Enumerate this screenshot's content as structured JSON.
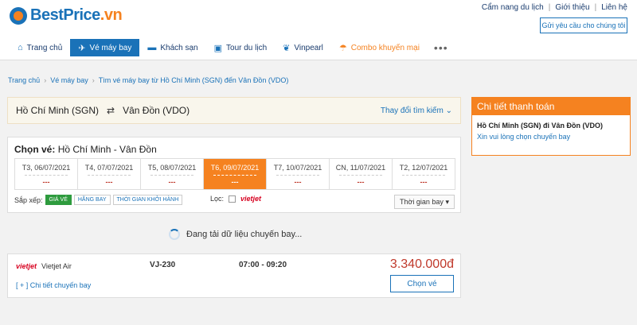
{
  "brand": {
    "name_main": "BestPrice",
    "name_suffix": ".vn"
  },
  "toplinks": [
    "Cẩm nang du lịch",
    "Giới thiệu",
    "Liên hệ"
  ],
  "support_button": "Gửi yêu cầu cho chúng tôi",
  "nav": [
    {
      "label": "Trang chủ",
      "icon": "home-icon"
    },
    {
      "label": "Vé máy bay",
      "icon": "plane-icon",
      "active": true
    },
    {
      "label": "Khách sạn",
      "icon": "bed-icon"
    },
    {
      "label": "Tour du lịch",
      "icon": "luggage-icon"
    },
    {
      "label": "Vinpearl",
      "icon": "vinpearl-icon"
    },
    {
      "label": "Combo khuyến mại",
      "icon": "beach-icon"
    }
  ],
  "nav_more": "•••",
  "breadcrumb": [
    "Trang chủ",
    "Vé máy bay",
    "Tìm vé máy bay từ Hồ Chí Minh (SGN) đến Vân Đồn (VDO)"
  ],
  "route": {
    "from": "Hồ Chí Minh (SGN)",
    "swap_icon": "⇄",
    "to": "Vân Đồn (VDO)",
    "change_label": "Thay đổi tìm kiếm"
  },
  "select": {
    "title_prefix": "Chọn vé:",
    "title_route": "Hồ Chí Minh - Vân Đồn"
  },
  "dates": [
    {
      "label": "T3, 06/07/2021",
      "price": "---"
    },
    {
      "label": "T4, 07/07/2021",
      "price": "---"
    },
    {
      "label": "T5, 08/07/2021",
      "price": "---"
    },
    {
      "label": "T6, 09/07/2021",
      "price": "---",
      "active": true
    },
    {
      "label": "T7, 10/07/2021",
      "price": "---"
    },
    {
      "label": "CN, 11/07/2021",
      "price": "---"
    },
    {
      "label": "T2, 12/07/2021",
      "price": "---"
    }
  ],
  "sort": {
    "label": "Sắp xếp:",
    "options": [
      "GIÁ VÉ",
      "HÃNG BAY",
      "THỜI GIAN KHỞI HÀNH"
    ]
  },
  "filter": {
    "label": "Lọc:",
    "airline": "vietjet"
  },
  "time_select": "Thời gian bay",
  "loading_text": "Đang tải dữ liệu chuyến bay...",
  "flight": {
    "airline_logo": "vietjet",
    "airline": "Vietjet Air",
    "code": "VJ-230",
    "time": "07:00 - 09:20",
    "price": "3.340.000đ",
    "detail_link": "[ + ] Chi tiết chuyến bay",
    "choose_label": "Chọn vé"
  },
  "payment": {
    "title": "Chi tiết thanh toán",
    "route": "Hồ Chí Minh (SGN) đi Vân Đồn (VDO)",
    "note": "Xin vui lòng chọn chuyến bay"
  }
}
